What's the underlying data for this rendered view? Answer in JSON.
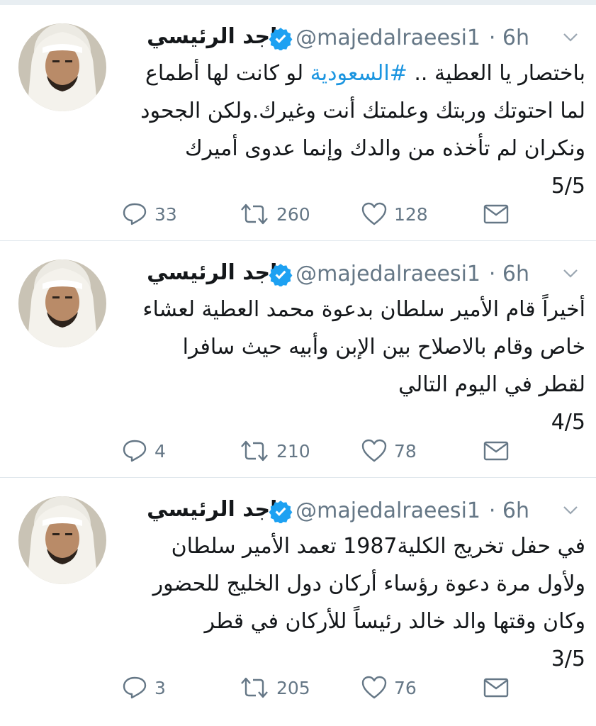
{
  "top_strip": "",
  "tweets": [
    {
      "name": "ماجد الرئيسي",
      "handle": "@majedalraeesi1",
      "time": "· 6h",
      "lines": [
        "باختصار يا العطية .. ",
        "لما احتوتك وربتك وعلمتك أنت وغيرك.ولكن الجحود",
        "ونكران لم تأخذه من والدك وإنما عدوى أميرك"
      ],
      "hashtag": "#السعودية",
      "line1_tail": " لو كانت لها أطماع",
      "counter": "5/5",
      "replies": "33",
      "retweets": "260",
      "likes": "128"
    },
    {
      "name": "ماجد الرئيسي",
      "handle": "@majedalraeesi1",
      "time": "· 6h",
      "lines": [
        "أخيراً قام الأمير سلطان بدعوة محمد العطية  لعشاء",
        "خاص وقام بالاصلاح بين الإبن وأبيه حيث سافرا",
        "لقطر في اليوم التالي"
      ],
      "counter": "4/5",
      "replies": "4",
      "retweets": "210",
      "likes": "78"
    },
    {
      "name": "ماجد الرئيسي",
      "handle": "@majedalraeesi1",
      "time": "· 6h",
      "lines": [
        "في حفل تخريج الكلية1987 تعمد الأمير سلطان",
        "ولأول مرة دعوة رؤساء أركان دول الخليج للحضور",
        "وكان وقتها والد خالد رئيساً للأركان في قطر"
      ],
      "counter": "3/5",
      "replies": "3",
      "retweets": "205",
      "likes": "76"
    }
  ],
  "icons": {
    "reply": "reply-icon",
    "retweet": "retweet-icon",
    "like": "heart-icon",
    "dm": "envelope-icon",
    "verified": "verified-badge-icon",
    "chevron": "chevron-down-icon"
  },
  "colors": {
    "text": "#14171a",
    "secondary": "#657786",
    "accent": "#1da1f2",
    "divider": "#e1e8ed"
  }
}
